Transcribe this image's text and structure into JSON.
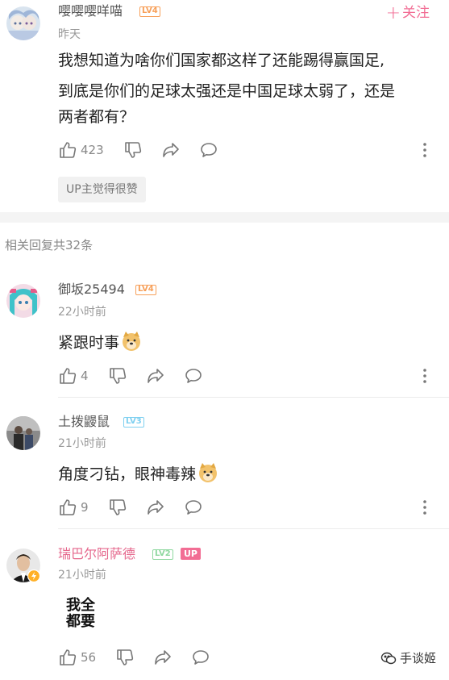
{
  "main_comment": {
    "username": "嘤嘤嘤咩喵",
    "level": "LV4",
    "time": "昨天",
    "follow_label": "关注",
    "content_lines": [
      "我想知道为啥你们国家都这样了还能踢得赢国足,",
      "到底是你们的足球太强还是中国足球太弱了，还是",
      "两者都有？"
    ],
    "like_count": "423",
    "tag": "UP主觉得很赞"
  },
  "replies_header": "相关回复共32条",
  "replies": [
    {
      "username": "御坂25494",
      "level": "LV4",
      "time": "22小时前",
      "content": "紧跟时事",
      "like_count": "4"
    },
    {
      "username": "土拨鼹鼠",
      "level": "LV3",
      "time": "21小时前",
      "content": "角度刁钻，眼神毒辣",
      "like_count": "9"
    },
    {
      "username": "瑞巴尔阿萨德",
      "level": "LV2",
      "badge": "UP",
      "time": "21小时前",
      "sticker_lines": [
        "我全",
        "都要"
      ],
      "like_count": "56"
    }
  ],
  "watermark": "手谈姬",
  "icons": [
    "like-icon",
    "dislike-icon",
    "share-icon",
    "comment-icon",
    "more-icon",
    "doge-emoji",
    "watermark-logo-icon"
  ],
  "colors": {
    "accent_pink": "#f26d94",
    "level4": "#f7a05a",
    "level3": "#7fd0f0",
    "level2": "#8fd8a0"
  }
}
